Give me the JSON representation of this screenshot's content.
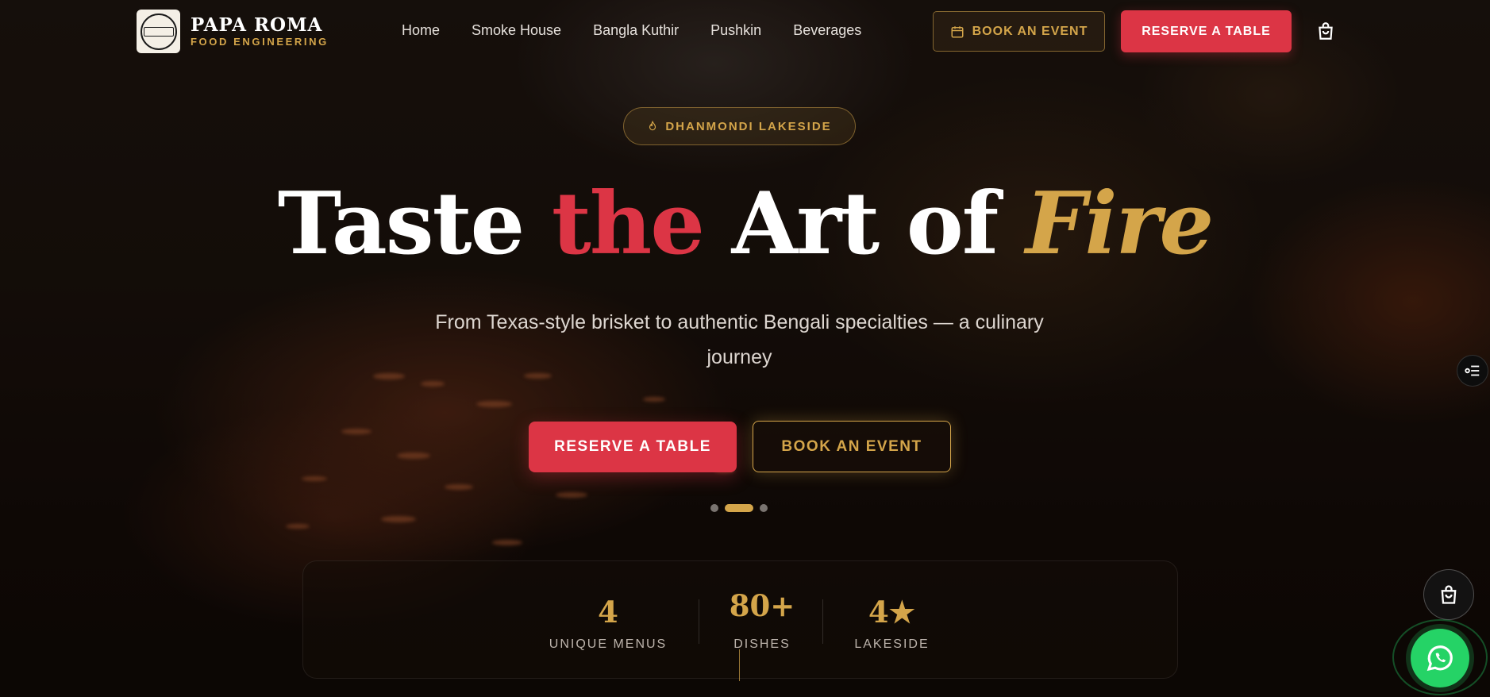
{
  "brand": {
    "name": "PAPA ROMA",
    "tagline": "FOOD ENGINEERING",
    "logo_text": "SMOKE HOUSE"
  },
  "nav": {
    "items": [
      "Home",
      "Smoke House",
      "Bangla Kuthir",
      "Pushkin",
      "Beverages"
    ]
  },
  "header": {
    "book_event_label": "BOOK AN EVENT",
    "reserve_label": "RESERVE A TABLE"
  },
  "hero": {
    "badge": "DHANMONDI LAKESIDE",
    "headline": {
      "w1": "Taste",
      "w2": "the",
      "w3": "Art of",
      "w4": "Fire"
    },
    "subtitle": "From Texas-style brisket to authentic Bengali specialties — a culinary journey",
    "reserve_label": "RESERVE A TABLE",
    "book_event_label": "BOOK AN EVENT",
    "slides": {
      "count": 3,
      "active": 2
    }
  },
  "stats": [
    {
      "value": "4",
      "label": "UNIQUE MENUS"
    },
    {
      "value": "80+",
      "label": "DISHES"
    },
    {
      "value": "4★",
      "label": "LAKESIDE"
    }
  ],
  "icons": {
    "calendar": "calendar-icon",
    "cart": "shopping-bag-icon",
    "flame": "flame-icon",
    "filter": "filter-icon",
    "whatsapp": "whatsapp-icon"
  },
  "colors": {
    "accent_red": "#dc3545",
    "accent_gold": "#d4a54a",
    "whatsapp_green": "#25d366"
  }
}
